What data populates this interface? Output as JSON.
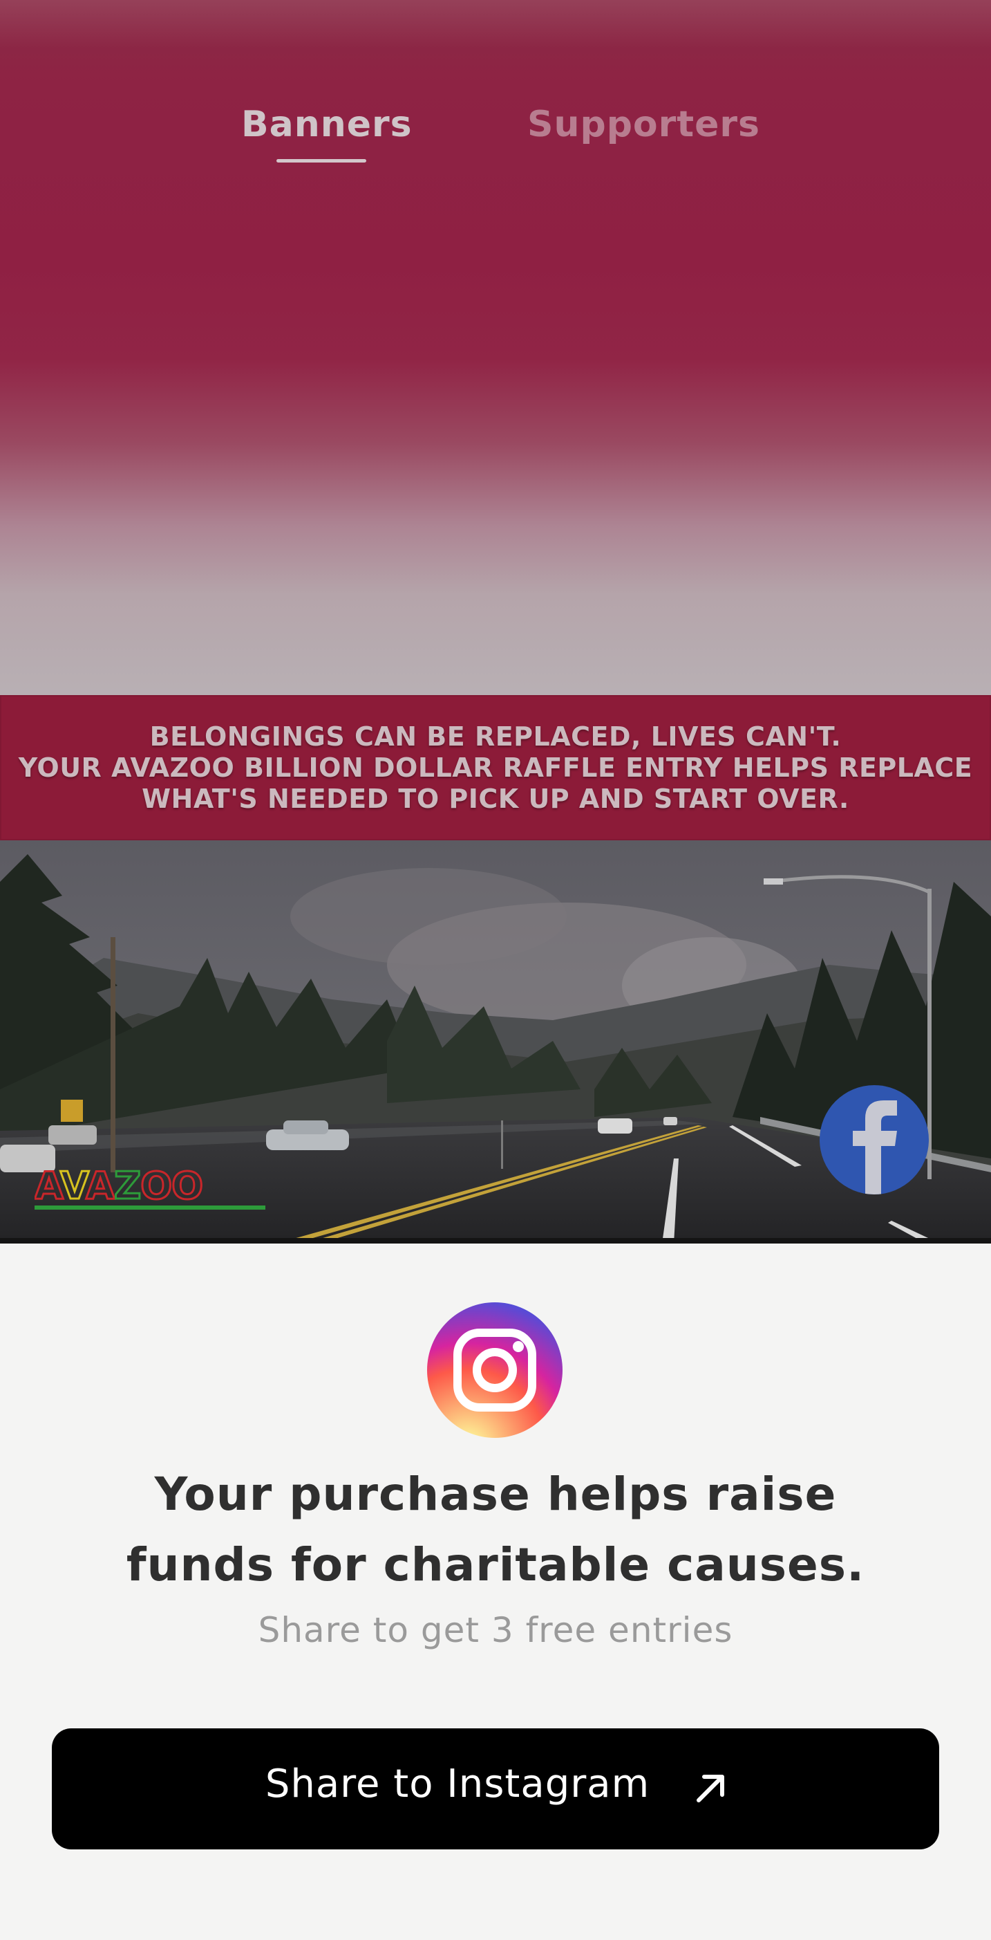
{
  "tabs": {
    "banners": "Banners",
    "supporters": "Supporters",
    "active": "Banners"
  },
  "banner": {
    "caption_line1": "BELONGINGS CAN BE REPLACED, LIVES CAN'T.",
    "caption_line2": "YOUR AVAZOO BILLION DOLLAR RAFFLE ENTRY HELPS REPLACE",
    "caption_line3": "WHAT'S NEEDED TO PICK UP AND START OVER.",
    "logo_text": "AVAZOO",
    "social_icon": "facebook-icon"
  },
  "share": {
    "icon": "instagram-icon",
    "headline_line1": "Your purchase helps raise",
    "headline_line2": "funds for charitable causes.",
    "subline": "Share to get 3 free entries",
    "button_label": "Share to Instagram",
    "button_icon": "arrow-up-right-icon"
  },
  "colors": {
    "top_gradient": "#8f2043",
    "caption_band": "#8c1b38",
    "facebook": "#2f56b0",
    "button": "#000000"
  }
}
